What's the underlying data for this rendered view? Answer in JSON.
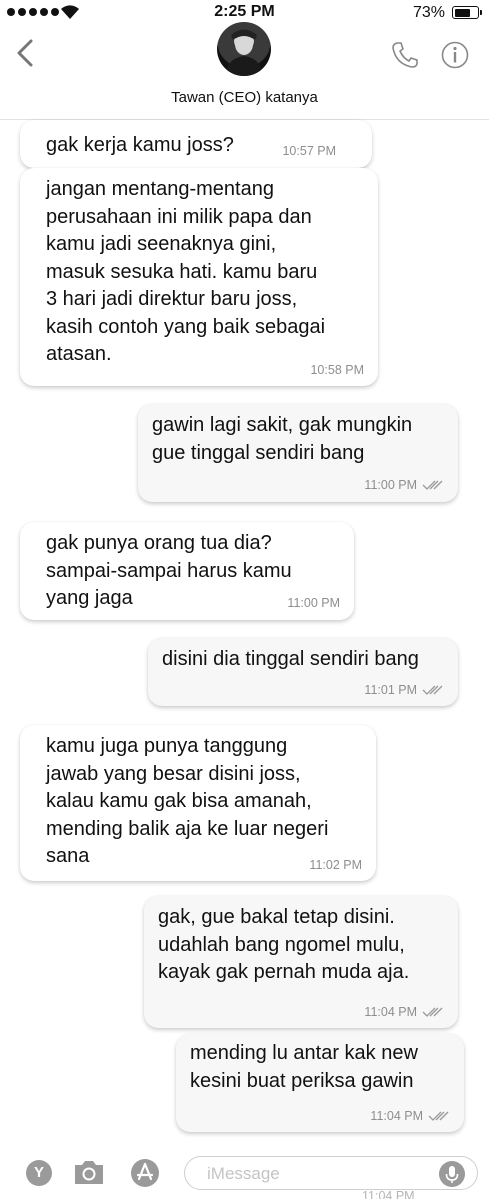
{
  "status_bar": {
    "time": "2:25 PM",
    "battery_percent": "73%",
    "battery_level": 0.73
  },
  "header": {
    "contact_name": "Tawan (CEO) katanya"
  },
  "messages": [
    {
      "dir": "in",
      "text": "gak kerja kamu joss?",
      "time": "10:57 PM",
      "read": false
    },
    {
      "dir": "in",
      "text": "jangan mentang-mentang\nperusahaan ini milik papa dan\nkamu jadi seenaknya gini,\nmasuk sesuka hati. kamu baru\n3 hari jadi direktur baru joss,\nkasih contoh yang baik sebagai\natasan.",
      "time": "10:58 PM",
      "read": false
    },
    {
      "dir": "out",
      "text": "gawin lagi sakit, gak mungkin\ngue tinggal sendiri bang",
      "time": "11:00 PM",
      "read": true
    },
    {
      "dir": "in",
      "text": "gak punya orang tua dia?\nsampai-sampai harus kamu\nyang jaga",
      "time": "11:00 PM",
      "read": false
    },
    {
      "dir": "out",
      "text": "disini dia tinggal sendiri bang",
      "time": "11:01 PM",
      "read": true
    },
    {
      "dir": "in",
      "text": "kamu juga punya tanggung\njawab yang besar disini joss,\nkalau kamu gak bisa amanah,\nmending balik aja ke luar negeri\nsana",
      "time": "11:02 PM",
      "read": false
    },
    {
      "dir": "out",
      "text": "gak, gue bakal tetap disini.\nudahlah bang ngomel mulu,\nkayak gak pernah muda aja.",
      "time": "11:04 PM",
      "read": true
    },
    {
      "dir": "out",
      "text": "mending lu antar kak new\nkesini buat periksa gawin",
      "time": "11:04 PM",
      "read": true
    }
  ],
  "input_bar": {
    "placeholder": "iMessage",
    "apps": [
      "Y"
    ],
    "partial_time": "11:04 PM"
  },
  "colors": {
    "bubble_in": "#ffffff",
    "bubble_out": "#f7f7f7",
    "meta": "#8e8e8e"
  },
  "icons": [
    "back-chevron-icon",
    "phone-icon",
    "info-icon",
    "camera-icon",
    "app-store-icon",
    "microphone-icon"
  ]
}
